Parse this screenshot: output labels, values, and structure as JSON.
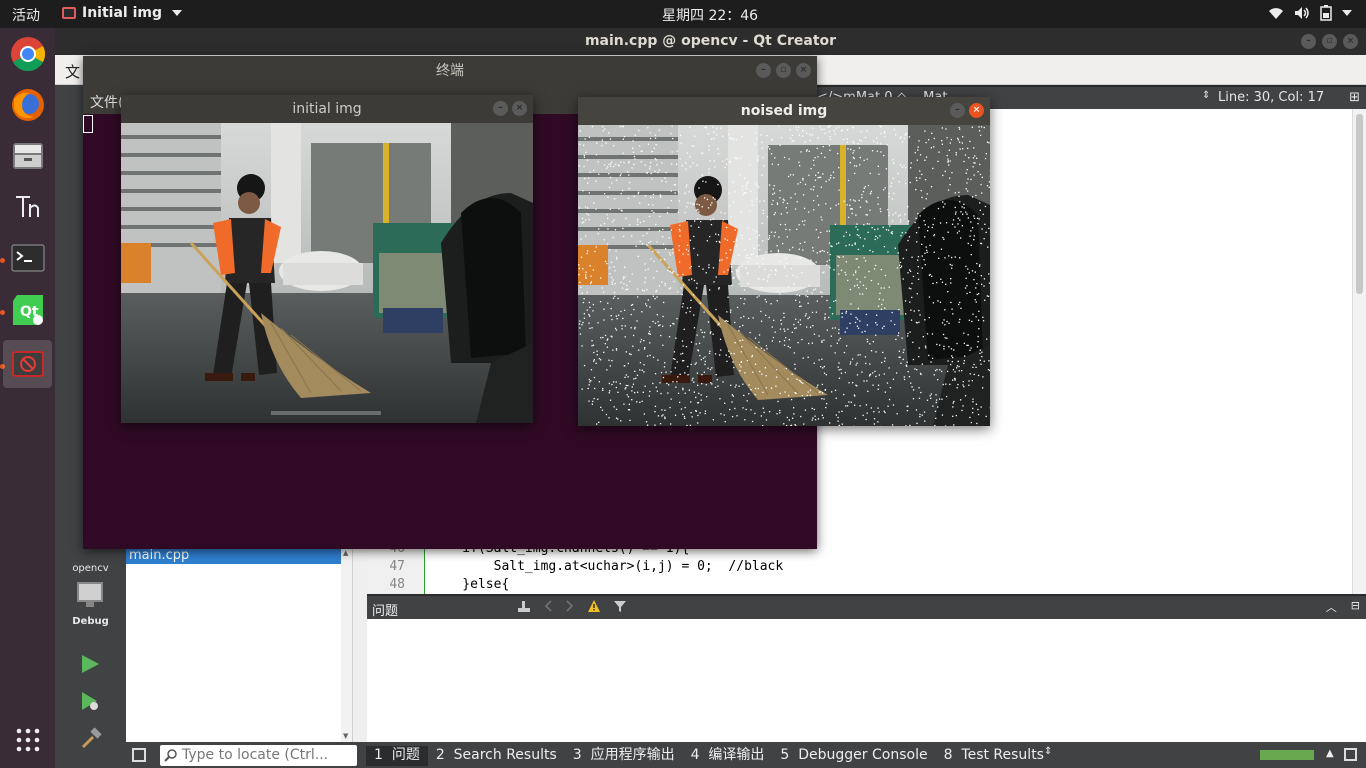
{
  "topbar": {
    "activities": "活动",
    "app_menu": "Initial img",
    "clock": "星期四 22：46"
  },
  "dock": {
    "items": [
      "chrome-icon",
      "firefox-icon",
      "files-icon",
      "font-viewer-icon",
      "terminal-icon",
      "qt-creator-icon",
      "disabled-app-icon",
      "app-grid-icon"
    ]
  },
  "qtcreator": {
    "window_title": "main.cpp @ opencv - Qt Creator",
    "menu_first": "文",
    "breadcrumb": "</>mMat 0 ◇ ...Mat",
    "line_col": "Line: 30, Col: 17",
    "project_name": "opencv",
    "kit_label": "Debug",
    "open_file": "main.cpp",
    "code": {
      "line_numbers": [
        "46",
        "47",
        "48"
      ],
      "lines": [
        "    if(Salt_img.channels() == 1){",
        "        Salt_img.at<uchar>(i,j) = 0;  //black",
        "    }else{"
      ]
    },
    "issues_title": "问题",
    "locator_placeholder": "Type to locate (Ctrl...",
    "output_tabs": [
      {
        "num": "1",
        "label": "问题"
      },
      {
        "num": "2",
        "label": "Search Results"
      },
      {
        "num": "3",
        "label": "应用程序输出"
      },
      {
        "num": "4",
        "label": "编译输出"
      },
      {
        "num": "5",
        "label": "Debugger Console"
      },
      {
        "num": "8",
        "label": "Test Results"
      }
    ]
  },
  "terminal": {
    "title": "终端",
    "menu_first": "文件("
  },
  "initial_window": {
    "title": "initial img"
  },
  "noised_window": {
    "title": "noised img"
  }
}
